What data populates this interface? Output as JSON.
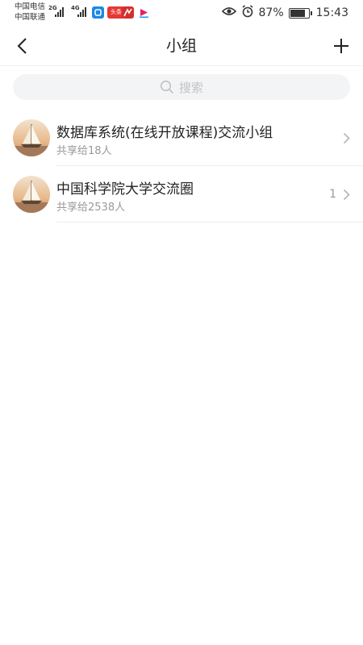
{
  "status_bar": {
    "carrier_1": "中国电信",
    "carrier_2": "中国联通",
    "network_1": "2G",
    "network_2": "4G",
    "apps": [
      {
        "name": "app-icon-blue",
        "color": "#1e88e5"
      },
      {
        "name": "toutiao-icon",
        "color": "#e53935",
        "label": "头条"
      },
      {
        "name": "chaoxing-icon",
        "color": "#d32f2f"
      },
      {
        "name": "video-app-icon",
        "color": "#e91e63"
      }
    ],
    "battery_level": 0.87,
    "battery": "87%",
    "time": "15:43"
  },
  "nav": {
    "title": "小组"
  },
  "search": {
    "placeholder": "搜索"
  },
  "groups": [
    {
      "title": "数据库系统(在线开放课程)交流小组",
      "subtitle": "共享给18人",
      "count": ""
    },
    {
      "title": "中国科学院大学交流圈",
      "subtitle": "共享给2538人",
      "count": "1"
    }
  ]
}
